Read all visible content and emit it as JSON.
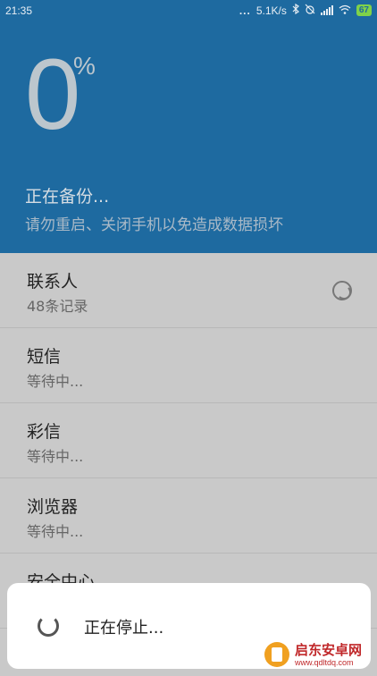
{
  "status_bar": {
    "time": "21:35",
    "dots": "...",
    "network_speed": "5.1K/s",
    "battery": "67"
  },
  "progress": {
    "percent": "0",
    "percent_sign": "%",
    "title": "正在备份...",
    "subtitle": "请勿重启、关闭手机以免造成数据损坏"
  },
  "items": [
    {
      "title": "联系人",
      "status": "48条记录"
    },
    {
      "title": "短信",
      "status": "等待中..."
    },
    {
      "title": "彩信",
      "status": "等待中..."
    },
    {
      "title": "浏览器",
      "status": "等待中..."
    },
    {
      "title": "安全中心",
      "status": ""
    }
  ],
  "dialog": {
    "text": "正在停止..."
  },
  "watermark": {
    "name": "启东安卓网",
    "url": "www.qdltdq.com"
  }
}
